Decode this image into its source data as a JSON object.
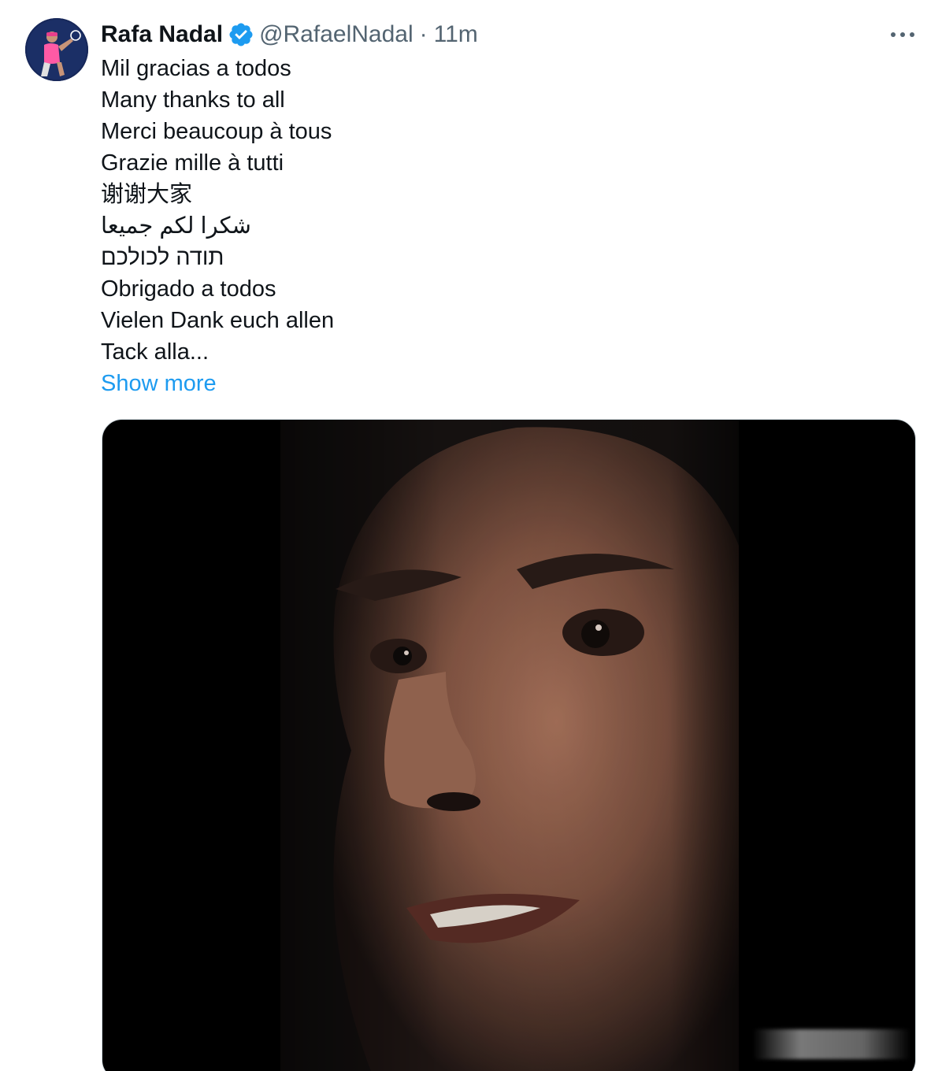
{
  "author": {
    "display_name": "Rafa Nadal",
    "handle": "@RafaelNadal",
    "separator": "·",
    "time": "11m",
    "verified": true,
    "avatar_icon": "tennis-player-avatar"
  },
  "more_icon": "more-horizontal-icon",
  "tweet": {
    "lines": [
      "Mil gracias a todos",
      "Many thanks to all",
      "Merci beaucoup à tous",
      "Grazie mille à tutti",
      "谢谢大家",
      "شكرا لكم جميعا",
      "תודה לכולכם",
      "Obrigado a todos",
      "Vielen Dank euch allen",
      "Tack alla..."
    ],
    "show_more": "Show more"
  },
  "media": {
    "type": "video",
    "description_icon": "video-thumbnail-portrait"
  },
  "colors": {
    "link": "#1d9bf0",
    "verified_badge": "#1d9bf0",
    "secondary_text": "#536471",
    "primary_text": "#0f1419"
  }
}
